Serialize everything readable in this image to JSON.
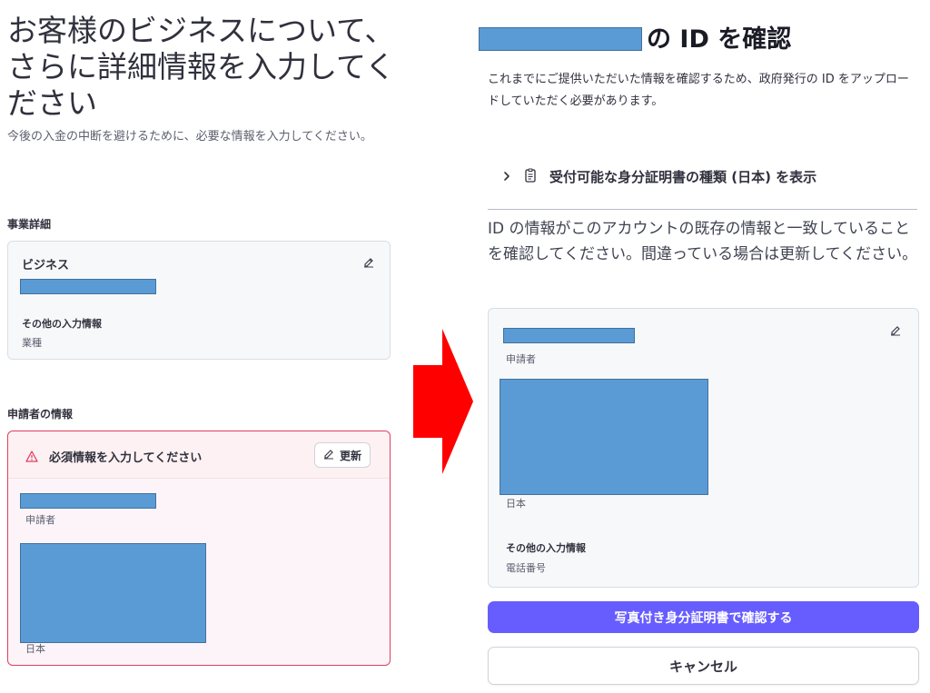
{
  "left": {
    "title": "お客様のビジネスについて、さらに詳細情報を入力してください",
    "subtitle": "今後の入金の中断を避けるために、必要な情報を入力してください。",
    "business_section": {
      "label": "事業詳細",
      "card_title": "ビジネス",
      "other_info_label": "その他の入力情報",
      "other_info_value": "業種",
      "edit_icon": "edit-icon"
    },
    "applicant_section": {
      "label": "申請者の情報",
      "warning_text": "必須情報を入力してください",
      "warning_icon": "alert-triangle-icon",
      "update_button": "更新",
      "role": "申請者",
      "country": "日本"
    }
  },
  "right": {
    "title": "の ID を確認",
    "description": "これまでにご提供いただいた情報を確認するため、政府発行の ID をアップロードしていただく必要があります。",
    "expander_label": "受付可能な身分証明書の種類 (日本) を表示",
    "notice": "ID の情報がこのアカウントの既存の情報と一致していることを確認してください。間違っている場合は更新してください。",
    "card": {
      "role": "申請者",
      "country": "日本",
      "other_info_label": "その他の入力情報",
      "other_info_value": "電話番号"
    },
    "primary_button": "写真付き身分証明書で確認する",
    "cancel_button": "キャンセル"
  },
  "colors": {
    "primary": "#675dff",
    "warning_border": "#df3f5f",
    "arrow": "#ff0000",
    "redaction": "#5b9bd5"
  }
}
